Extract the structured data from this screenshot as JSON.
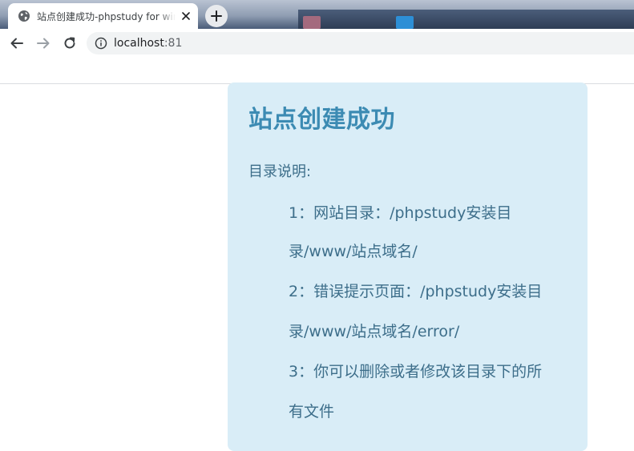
{
  "browser": {
    "tab": {
      "title": "站点创建成功-phpstudy for windows",
      "favicon": "globe-icon"
    },
    "new_tab_symbol": "+",
    "url_host": "localhost",
    "url_port": ":81"
  },
  "page": {
    "heading": "站点创建成功",
    "intro": "目录说明:",
    "lines": [
      "1：网站目录：/phpstudy安装目",
      "录/www/站点域名/",
      "2：错误提示页面：/phpstudy安装目",
      "录/www/站点域名/error/",
      "3：你可以删除或者修改该目录下的所",
      "有文件"
    ]
  },
  "colors": {
    "card_background": "#d9edf7",
    "heading": "#3c8bb3",
    "body_text": "#3d6e8a",
    "omnibox": "#f1f3f4"
  }
}
